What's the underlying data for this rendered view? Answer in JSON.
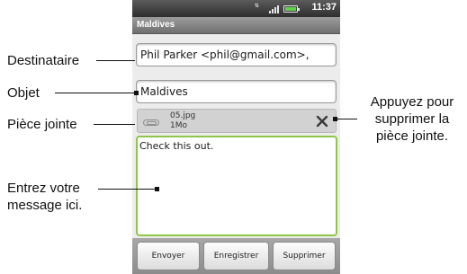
{
  "status_bar": {
    "time": "11:37",
    "data_icon": "data-transfer-icon",
    "signal_icon": "signal-icon",
    "battery_icon": "battery-icon",
    "battery_color": "#5fd24a"
  },
  "title_bar": {
    "title": "Maldives"
  },
  "compose": {
    "to_value": "Phil Parker <phil@gmail.com>,",
    "subject_value": "Maldives",
    "attachment": {
      "icon": "paperclip-icon",
      "name": "05.jpg",
      "size": "1Mo",
      "remove_icon": "close-icon"
    },
    "body_value": "Check this out.",
    "body_border_color": "#8ec645"
  },
  "buttons": {
    "send": "Envoyer",
    "save": "Enregistrer",
    "delete": "Supprimer"
  },
  "callouts": {
    "to": "Destinataire",
    "subject": "Objet",
    "attachment": "Pièce jointe",
    "message_line1": "Entrez votre",
    "message_line2": "message ici.",
    "remove_line1": "Appuyez pour",
    "remove_line2": "supprimer la",
    "remove_line3": "pièce jointe."
  }
}
